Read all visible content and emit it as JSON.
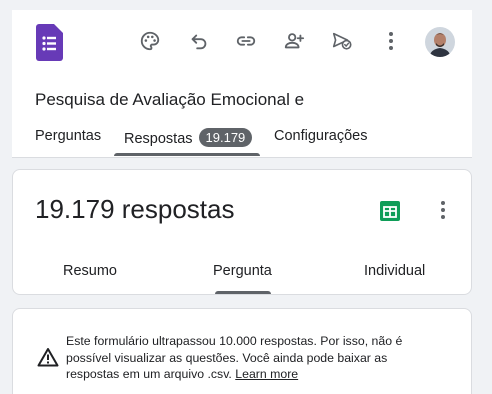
{
  "form": {
    "title": "Pesquisa de Avaliação Emocional e"
  },
  "toolbar": {
    "icons": [
      "palette-icon",
      "undo-icon",
      "link-icon",
      "add-collaborator-icon",
      "send-icon",
      "more-vert-icon"
    ]
  },
  "tabs": {
    "questions": "Perguntas",
    "responses": "Respostas",
    "responses_count": "19.179",
    "settings": "Configurações"
  },
  "summary": {
    "heading": "19.179 respostas",
    "subtabs": {
      "summary": "Resumo",
      "question": "Pergunta",
      "individual": "Individual"
    }
  },
  "notice": {
    "text": "Este formulário ultrapassou 10.000 respostas. Por isso, não é possível visualizar as questões. Você ainda pode baixar as respostas em um arquivo .csv.",
    "link": "Learn more"
  },
  "colors": {
    "forms_purple": "#673ab7",
    "sheets_green": "#0f9d58",
    "icon_gray": "#5f6368"
  }
}
